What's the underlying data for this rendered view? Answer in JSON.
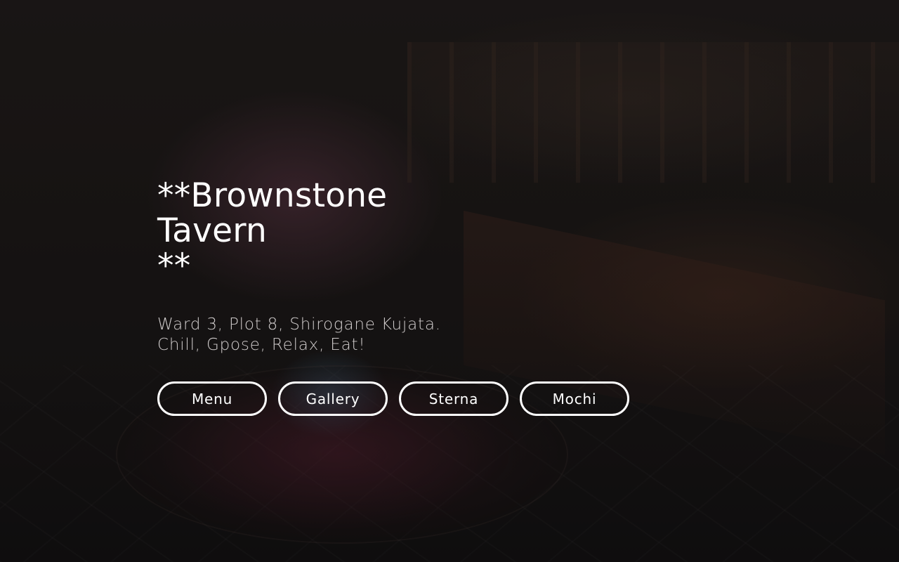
{
  "hero": {
    "title": "**Brownstone Tavern\n**",
    "subtitle_line1": "Ward 3, Plot 8, Shirogane Kujata.",
    "subtitle_line2": "Chill, Gpose, Relax, Eat!"
  },
  "buttons": [
    {
      "label": "Menu"
    },
    {
      "label": "Gallery"
    },
    {
      "label": "Sterna"
    },
    {
      "label": "Mochi"
    }
  ],
  "colors": {
    "text": "#ffffff",
    "subtitle": "#cfcbcb",
    "background": "#141212"
  }
}
